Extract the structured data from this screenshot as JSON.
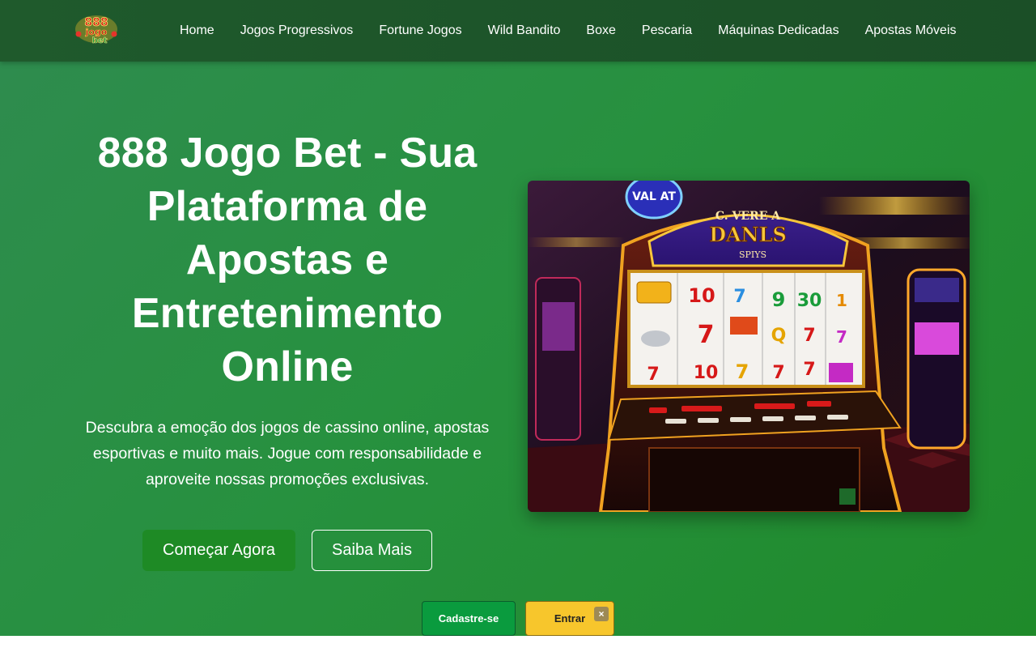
{
  "header": {
    "logo_text": "888 jogo bet",
    "nav": [
      {
        "label": "Home"
      },
      {
        "label": "Jogos Progressivos"
      },
      {
        "label": "Fortune Jogos"
      },
      {
        "label": "Wild Bandito"
      },
      {
        "label": "Boxe"
      },
      {
        "label": "Pescaria"
      },
      {
        "label": "Máquinas Dedicadas"
      },
      {
        "label": "Apostas Móveis"
      }
    ]
  },
  "hero": {
    "title": "888 Jogo Bet - Sua Plataforma de Apostas e Entretenimento Online",
    "subtitle": "Descubra a emoção dos jogos de cassino online, apostas esportivas e muito mais. Jogue com responsabilidade e aproveite nossas promoções exclusivas.",
    "primary_cta": "Começar Agora",
    "secondary_cta": "Saiba Mais",
    "image": {
      "subject": "slot-machine",
      "sign_text": "VAL AT",
      "marquee_line1": "C. VERE A",
      "marquee_line2": "DANLS",
      "marquee_line3": "SPIYS",
      "reel_symbols": [
        "10",
        "7",
        "9",
        "30",
        "1",
        "7",
        "7",
        "Q",
        "7",
        "7",
        "10",
        "7",
        "7",
        "7"
      ]
    }
  },
  "sticky_bar": {
    "register_label": "Cadastre-se",
    "login_label": "Entrar",
    "close_symbol": "×"
  },
  "colors": {
    "header_bg": "#1f5a2c",
    "hero_bg": "#2a8d45",
    "primary_button": "#1e8a25",
    "register_button": "#0a9b3e",
    "login_button": "#f7c62c"
  }
}
